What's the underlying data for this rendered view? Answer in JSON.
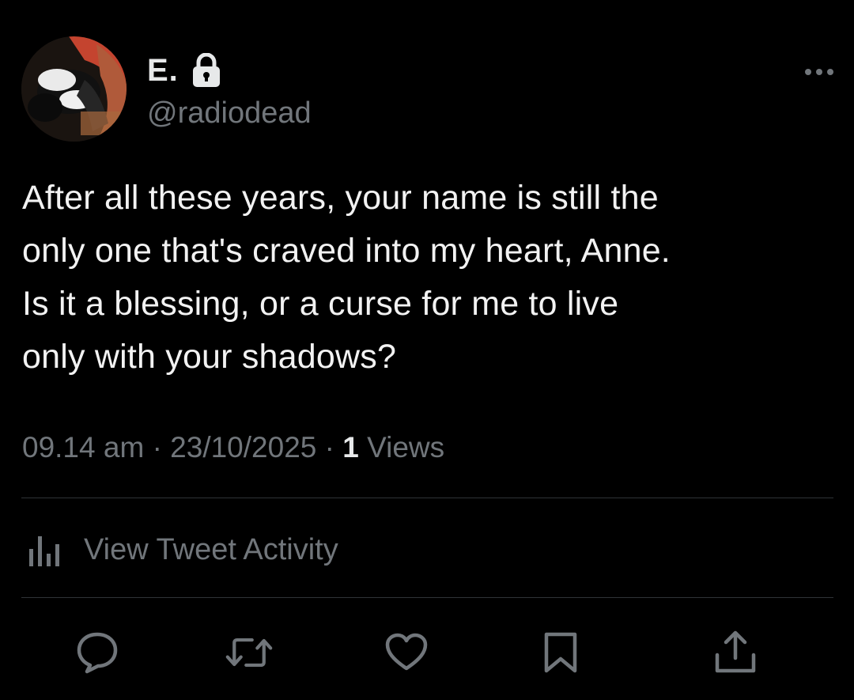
{
  "tweet": {
    "author": {
      "display_name": "E.",
      "handle": "@radiodead",
      "protected_icon": "lock-icon",
      "avatar_icon": "avatar-photo"
    },
    "text_lines": [
      "After all these years, your name is still the",
      "only one that's craved into my heart, Anne.",
      "Is it a blessing, or a curse for me to live",
      "only with your shadows?"
    ],
    "time": "09.14 am",
    "separator": "·",
    "date": "23/10/2025",
    "views_count": "1",
    "views_label": "Views"
  },
  "activity": {
    "label": "View Tweet Activity",
    "icon": "bar-chart-icon"
  },
  "actions": {
    "reply_icon": "reply-icon",
    "retweet_icon": "retweet-icon",
    "like_icon": "heart-icon",
    "bookmark_icon": "bookmark-icon",
    "share_icon": "share-icon"
  },
  "colors": {
    "background": "#000000",
    "primary_text": "#e7e9ea",
    "secondary_text": "#71767b",
    "divider": "#2f3336"
  }
}
